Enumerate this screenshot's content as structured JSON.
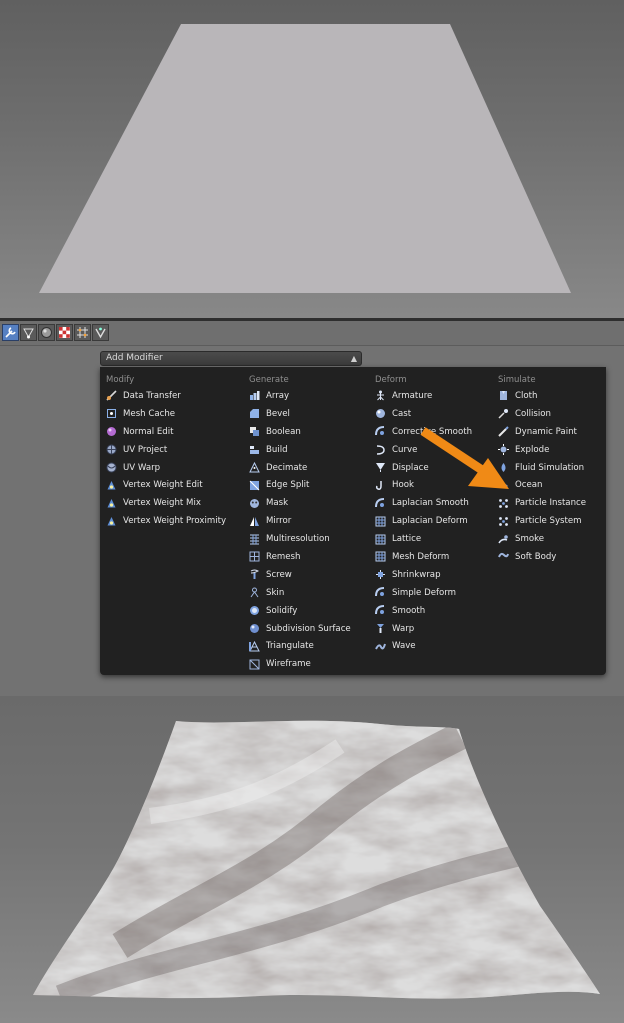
{
  "properties_tabs": [
    {
      "name": "wrench-icon",
      "active": true
    },
    {
      "name": "vertex-icon",
      "active": false
    },
    {
      "name": "material-sphere-icon",
      "active": false
    },
    {
      "name": "texture-checker-icon",
      "active": false
    },
    {
      "name": "particles-icon",
      "active": false
    },
    {
      "name": "physics-icon",
      "active": false
    }
  ],
  "add_modifier": {
    "label": "Add Modifier"
  },
  "menu": {
    "columns": [
      {
        "header": "Modify",
        "items": [
          {
            "label": "Data Transfer",
            "icon": "data-transfer-icon"
          },
          {
            "label": "Mesh Cache",
            "icon": "mesh-cache-icon"
          },
          {
            "label": "Normal Edit",
            "icon": "normal-edit-icon"
          },
          {
            "label": "UV Project",
            "icon": "uv-project-icon"
          },
          {
            "label": "UV Warp",
            "icon": "uv-warp-icon"
          },
          {
            "label": "Vertex Weight Edit",
            "icon": "vertex-weight-icon"
          },
          {
            "label": "Vertex Weight Mix",
            "icon": "vertex-weight-icon"
          },
          {
            "label": "Vertex Weight Proximity",
            "icon": "vertex-weight-icon"
          }
        ]
      },
      {
        "header": "Generate",
        "items": [
          {
            "label": "Array",
            "icon": "array-icon"
          },
          {
            "label": "Bevel",
            "icon": "bevel-icon"
          },
          {
            "label": "Boolean",
            "icon": "boolean-icon"
          },
          {
            "label": "Build",
            "icon": "build-icon"
          },
          {
            "label": "Decimate",
            "icon": "decimate-icon"
          },
          {
            "label": "Edge Split",
            "icon": "edge-split-icon"
          },
          {
            "label": "Mask",
            "icon": "mask-icon"
          },
          {
            "label": "Mirror",
            "icon": "mirror-icon"
          },
          {
            "label": "Multiresolution",
            "icon": "multiresolution-icon"
          },
          {
            "label": "Remesh",
            "icon": "remesh-icon"
          },
          {
            "label": "Screw",
            "icon": "screw-icon"
          },
          {
            "label": "Skin",
            "icon": "skin-icon"
          },
          {
            "label": "Solidify",
            "icon": "solidify-icon"
          },
          {
            "label": "Subdivision Surface",
            "icon": "subdivision-surface-icon"
          },
          {
            "label": "Triangulate",
            "icon": "triangulate-icon"
          },
          {
            "label": "Wireframe",
            "icon": "wireframe-icon"
          }
        ]
      },
      {
        "header": "Deform",
        "items": [
          {
            "label": "Armature",
            "icon": "armature-icon"
          },
          {
            "label": "Cast",
            "icon": "cast-icon"
          },
          {
            "label": "Corrective Smooth",
            "icon": "smooth-icon"
          },
          {
            "label": "Curve",
            "icon": "curve-icon"
          },
          {
            "label": "Displace",
            "icon": "displace-icon"
          },
          {
            "label": "Hook",
            "icon": "hook-icon"
          },
          {
            "label": "Laplacian Smooth",
            "icon": "smooth-icon"
          },
          {
            "label": "Laplacian Deform",
            "icon": "lattice-icon"
          },
          {
            "label": "Lattice",
            "icon": "lattice-icon"
          },
          {
            "label": "Mesh Deform",
            "icon": "lattice-icon"
          },
          {
            "label": "Shrinkwrap",
            "icon": "shrinkwrap-icon"
          },
          {
            "label": "Simple Deform",
            "icon": "smooth-icon"
          },
          {
            "label": "Smooth",
            "icon": "smooth-icon"
          },
          {
            "label": "Warp",
            "icon": "warp-icon"
          },
          {
            "label": "Wave",
            "icon": "wave-icon"
          }
        ]
      },
      {
        "header": "Simulate",
        "items": [
          {
            "label": "Cloth",
            "icon": "cloth-icon"
          },
          {
            "label": "Collision",
            "icon": "collision-icon"
          },
          {
            "label": "Dynamic Paint",
            "icon": "dynamic-paint-icon"
          },
          {
            "label": "Explode",
            "icon": "explode-icon"
          },
          {
            "label": "Fluid Simulation",
            "icon": "fluid-simulation-icon"
          },
          {
            "label": "Ocean",
            "icon": "ocean-icon"
          },
          {
            "label": "Particle Instance",
            "icon": "particles-icon"
          },
          {
            "label": "Particle System",
            "icon": "particles-icon"
          },
          {
            "label": "Smoke",
            "icon": "smoke-icon"
          },
          {
            "label": "Soft Body",
            "icon": "soft-body-icon"
          }
        ]
      }
    ]
  },
  "colors": {
    "accent_arrow": "#f08a16",
    "menu_bg": "#212121",
    "active_tab": "#5680c2"
  }
}
